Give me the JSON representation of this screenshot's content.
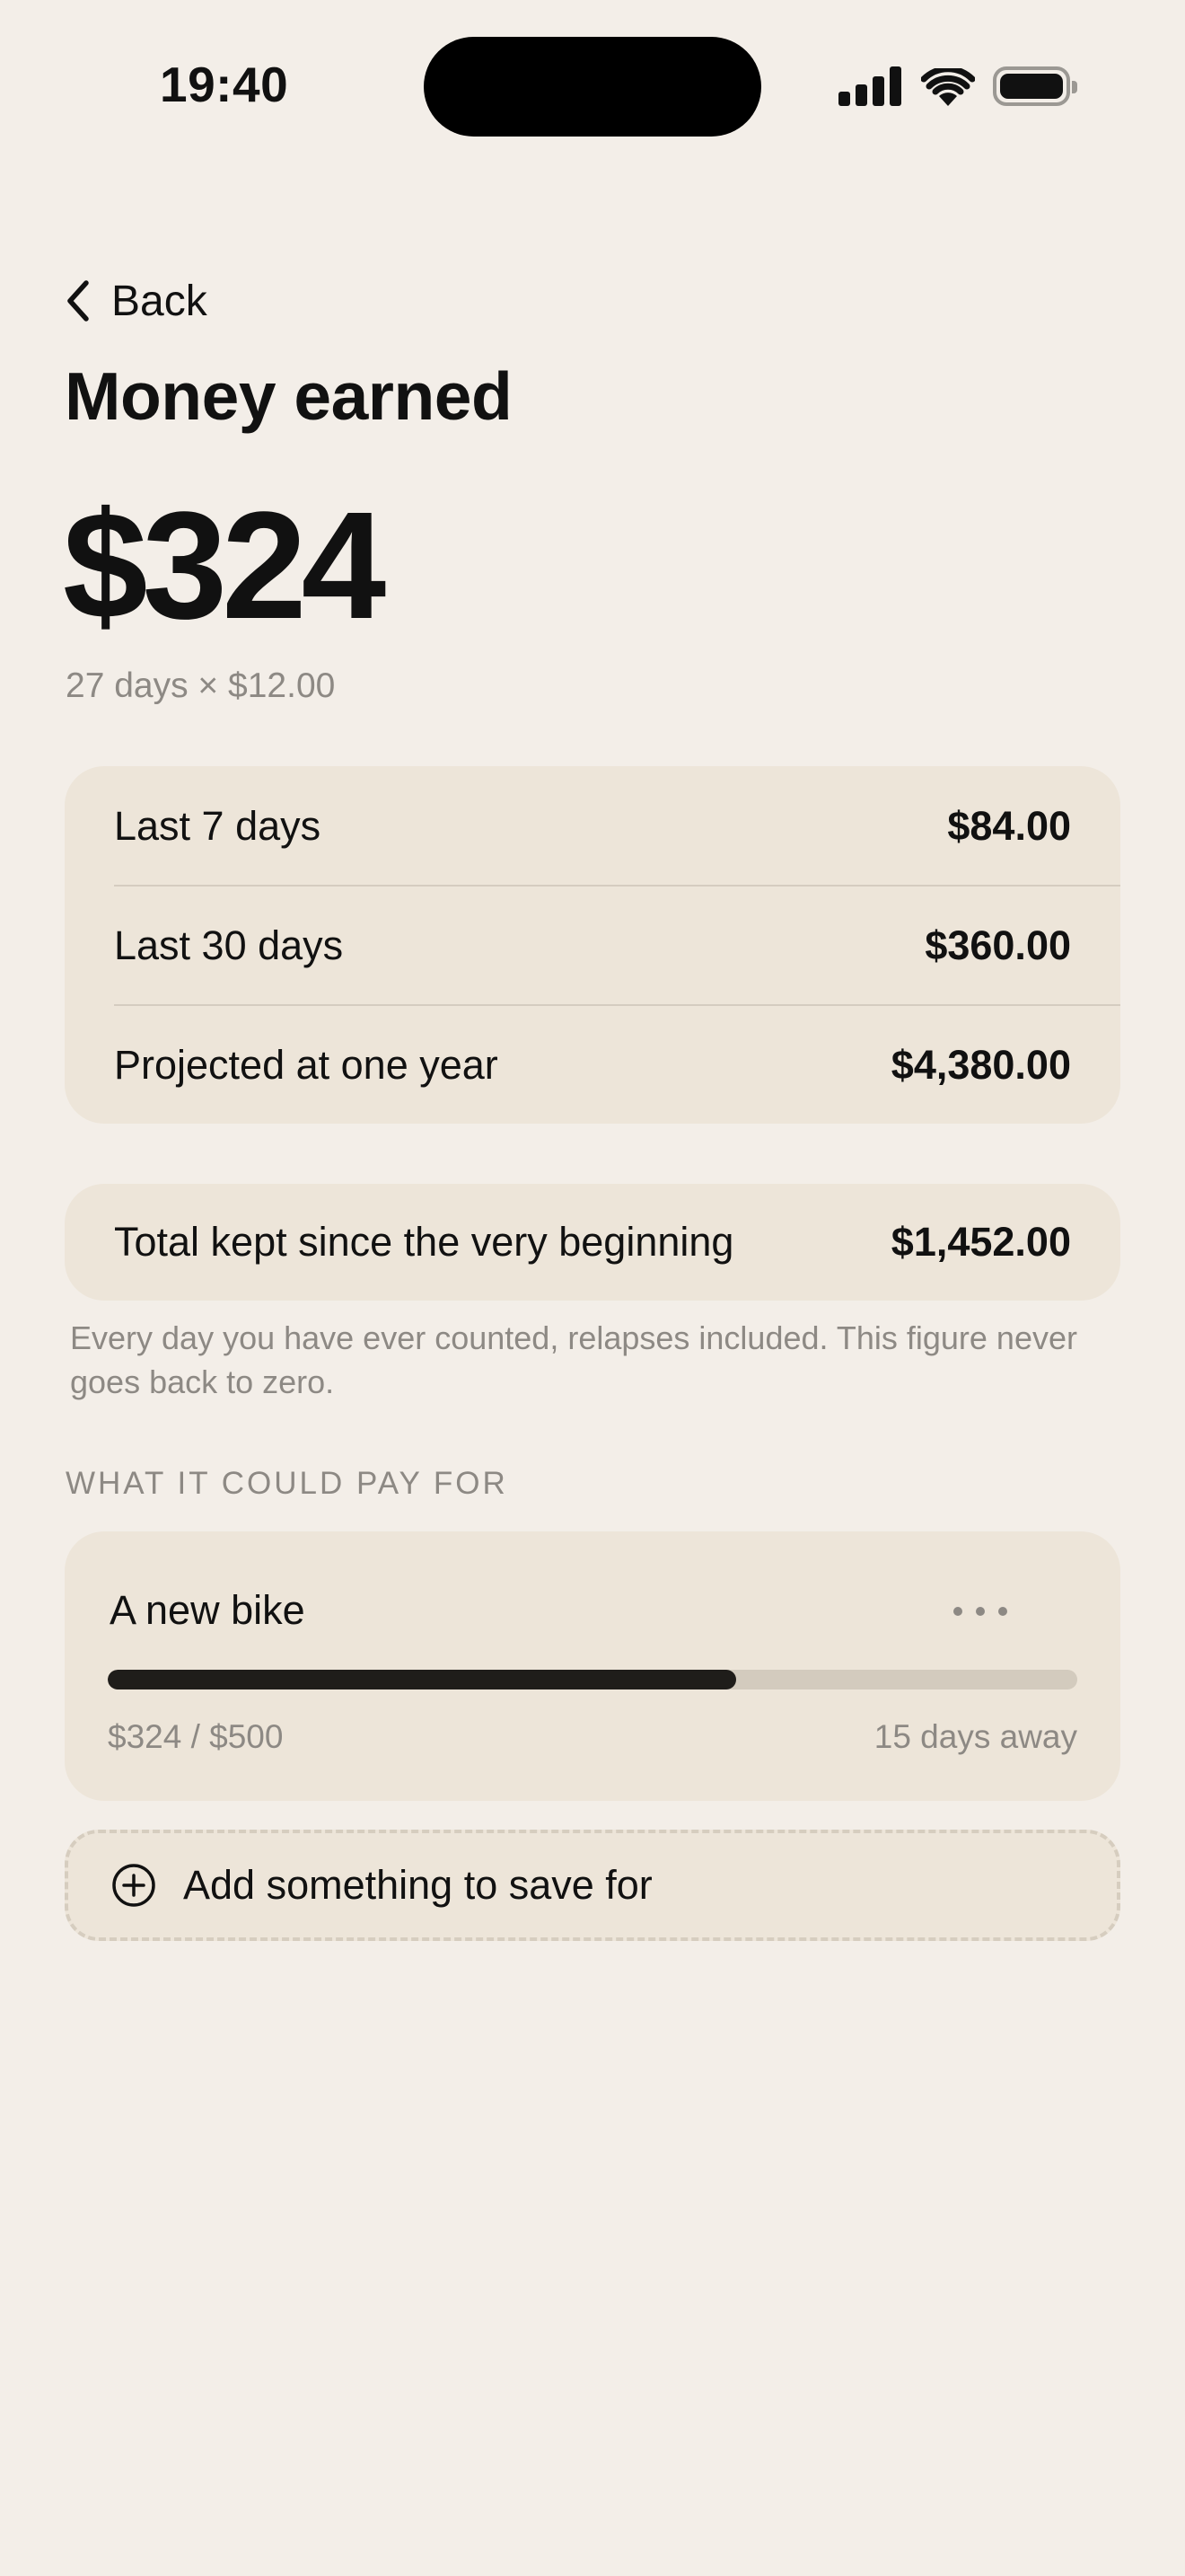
{
  "status_bar": {
    "time": "19:40"
  },
  "nav": {
    "back_label": "Back"
  },
  "page": {
    "title": "Money earned",
    "hero_amount": "$324",
    "hero_subtitle": "27 days × $12.00"
  },
  "stats": [
    {
      "label": "Last 7 days",
      "value": "$84.00"
    },
    {
      "label": "Last 30 days",
      "value": "$360.00"
    },
    {
      "label": "Projected at one year",
      "value": "$4,380.00"
    }
  ],
  "total": {
    "label": "Total kept since the very beginning",
    "value": "$1,452.00",
    "note": "Every day you have ever counted, relapses included. This figure never goes back to zero."
  },
  "goals": {
    "section_title": "WHAT IT COULD PAY FOR",
    "items": [
      {
        "name": "A new bike",
        "amount_text": "$324 / $500",
        "eta": "15 days away",
        "progress": 0.648
      }
    ],
    "add_label": "Add something to save for"
  },
  "icons": {
    "back": "chevron-left-icon",
    "more": "more-horizontal-icon",
    "add": "plus-circle-icon",
    "signal": "cellular-signal-icon",
    "wifi": "wifi-icon",
    "battery": "battery-icon"
  },
  "colors": {
    "background": "#F3EEE8",
    "card": "#EDE5D9",
    "progress_fill": "#1F1D1A",
    "progress_track": "#D3CBBE",
    "muted_text": "#8D8984"
  }
}
